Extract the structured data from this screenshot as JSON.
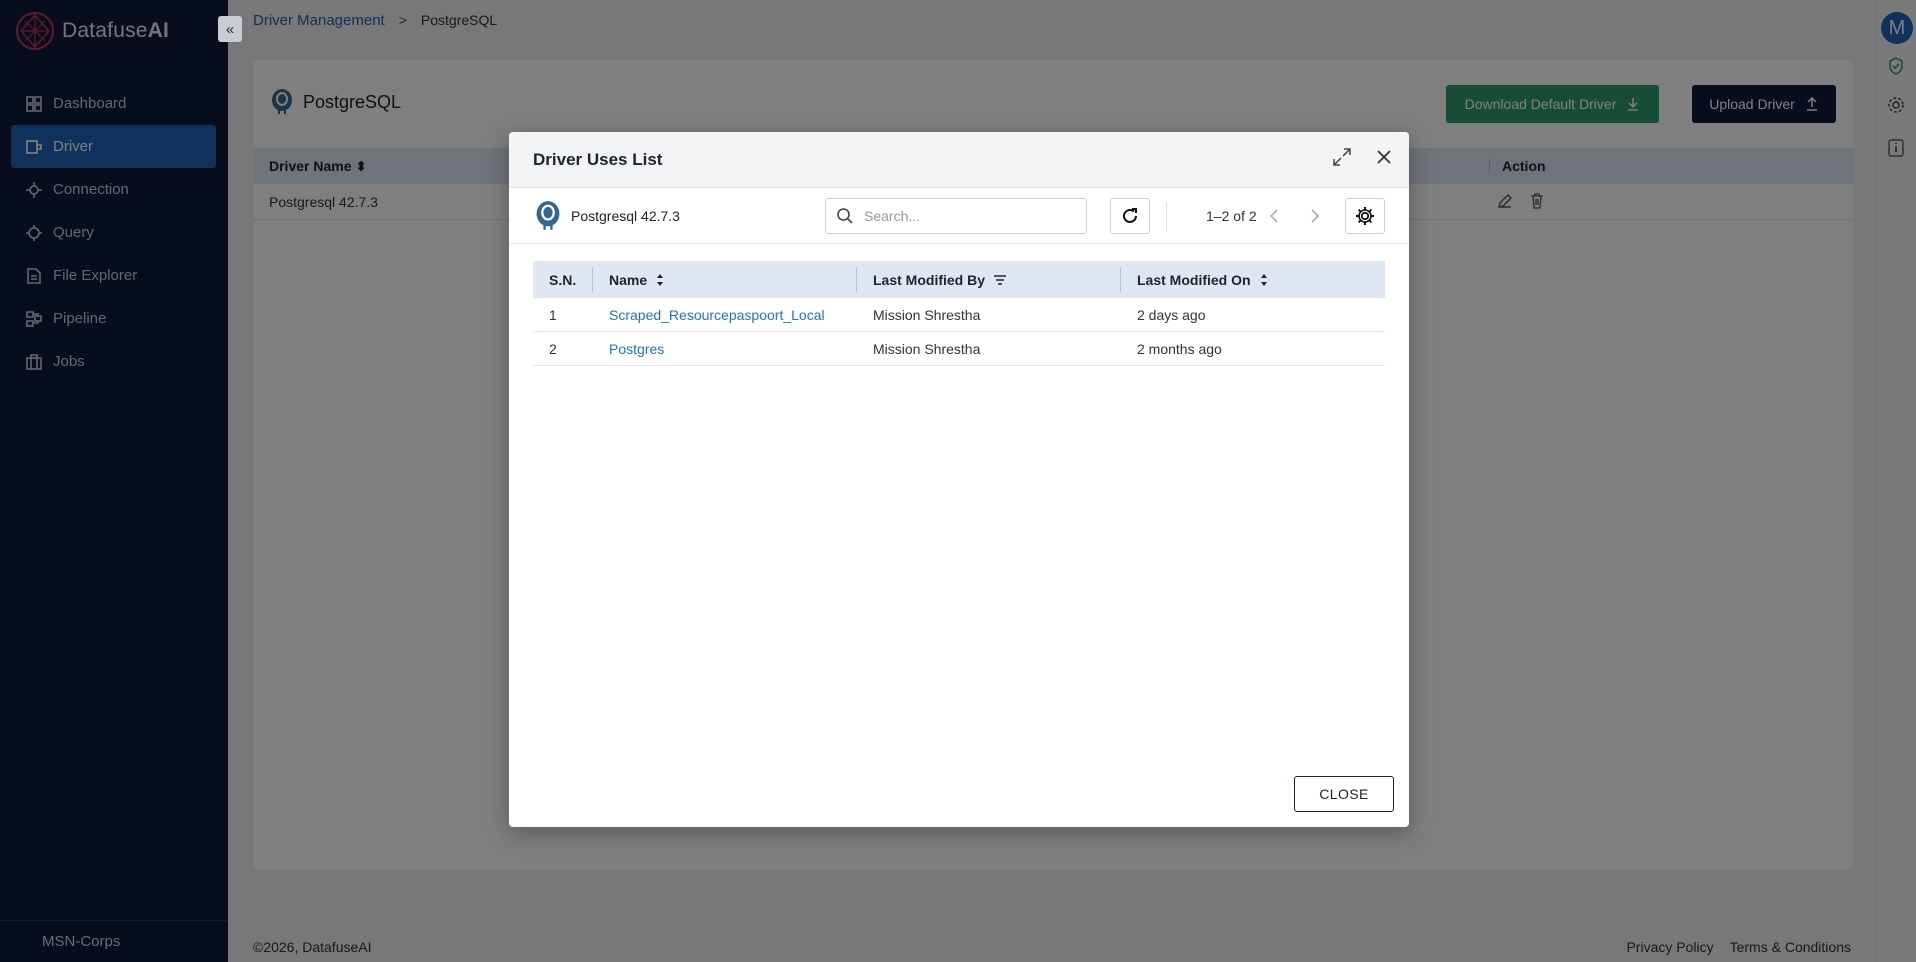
{
  "app": {
    "brand_name": "Datafuse",
    "brand_suffix": "AI",
    "org_name": "MSN-Corps",
    "avatar_initial": "M",
    "accent_color": "#1f63b6",
    "sidebar_color": "#0f1a3a"
  },
  "sidebar": {
    "items": [
      {
        "label": "Dashboard",
        "icon": "dashboard-icon",
        "active": false
      },
      {
        "label": "Driver",
        "icon": "driver-icon",
        "active": true
      },
      {
        "label": "Connection",
        "icon": "connection-icon",
        "active": false
      },
      {
        "label": "Query",
        "icon": "query-icon",
        "active": false
      },
      {
        "label": "File Explorer",
        "icon": "file-explorer-icon",
        "active": false
      },
      {
        "label": "Pipeline",
        "icon": "pipeline-icon",
        "active": false
      },
      {
        "label": "Jobs",
        "icon": "jobs-icon",
        "active": false
      }
    ]
  },
  "breadcrumb": {
    "parent": "Driver Management",
    "current": "PostgreSQL"
  },
  "page": {
    "title": "PostgreSQL",
    "download_label": "Download Default Driver",
    "upload_label": "Upload Driver",
    "table": {
      "headers": [
        "Driver Name",
        "Action"
      ],
      "rows": [
        [
          "Postgresql 42.7.3"
        ]
      ]
    }
  },
  "footer": {
    "copyright": "©2026, DatafuseAI",
    "privacy": "Privacy Policy",
    "terms": "Terms & Conditions"
  },
  "modal": {
    "title": "Driver Uses List",
    "driver_name": "Postgresql 42.7.3",
    "search_placeholder": "Search...",
    "pagination": "1–2 of 2",
    "columns": [
      "S.N.",
      "Name",
      "Last Modified By",
      "Last Modified On"
    ],
    "rows": [
      {
        "sn": "1",
        "name": "Scraped_Resourcepaspoort_Local",
        "by": "Mission Shrestha",
        "on": "2 days ago"
      },
      {
        "sn": "2",
        "name": "Postgres",
        "by": "Mission Shrestha",
        "on": "2 months ago"
      }
    ],
    "close_label": "CLOSE"
  }
}
